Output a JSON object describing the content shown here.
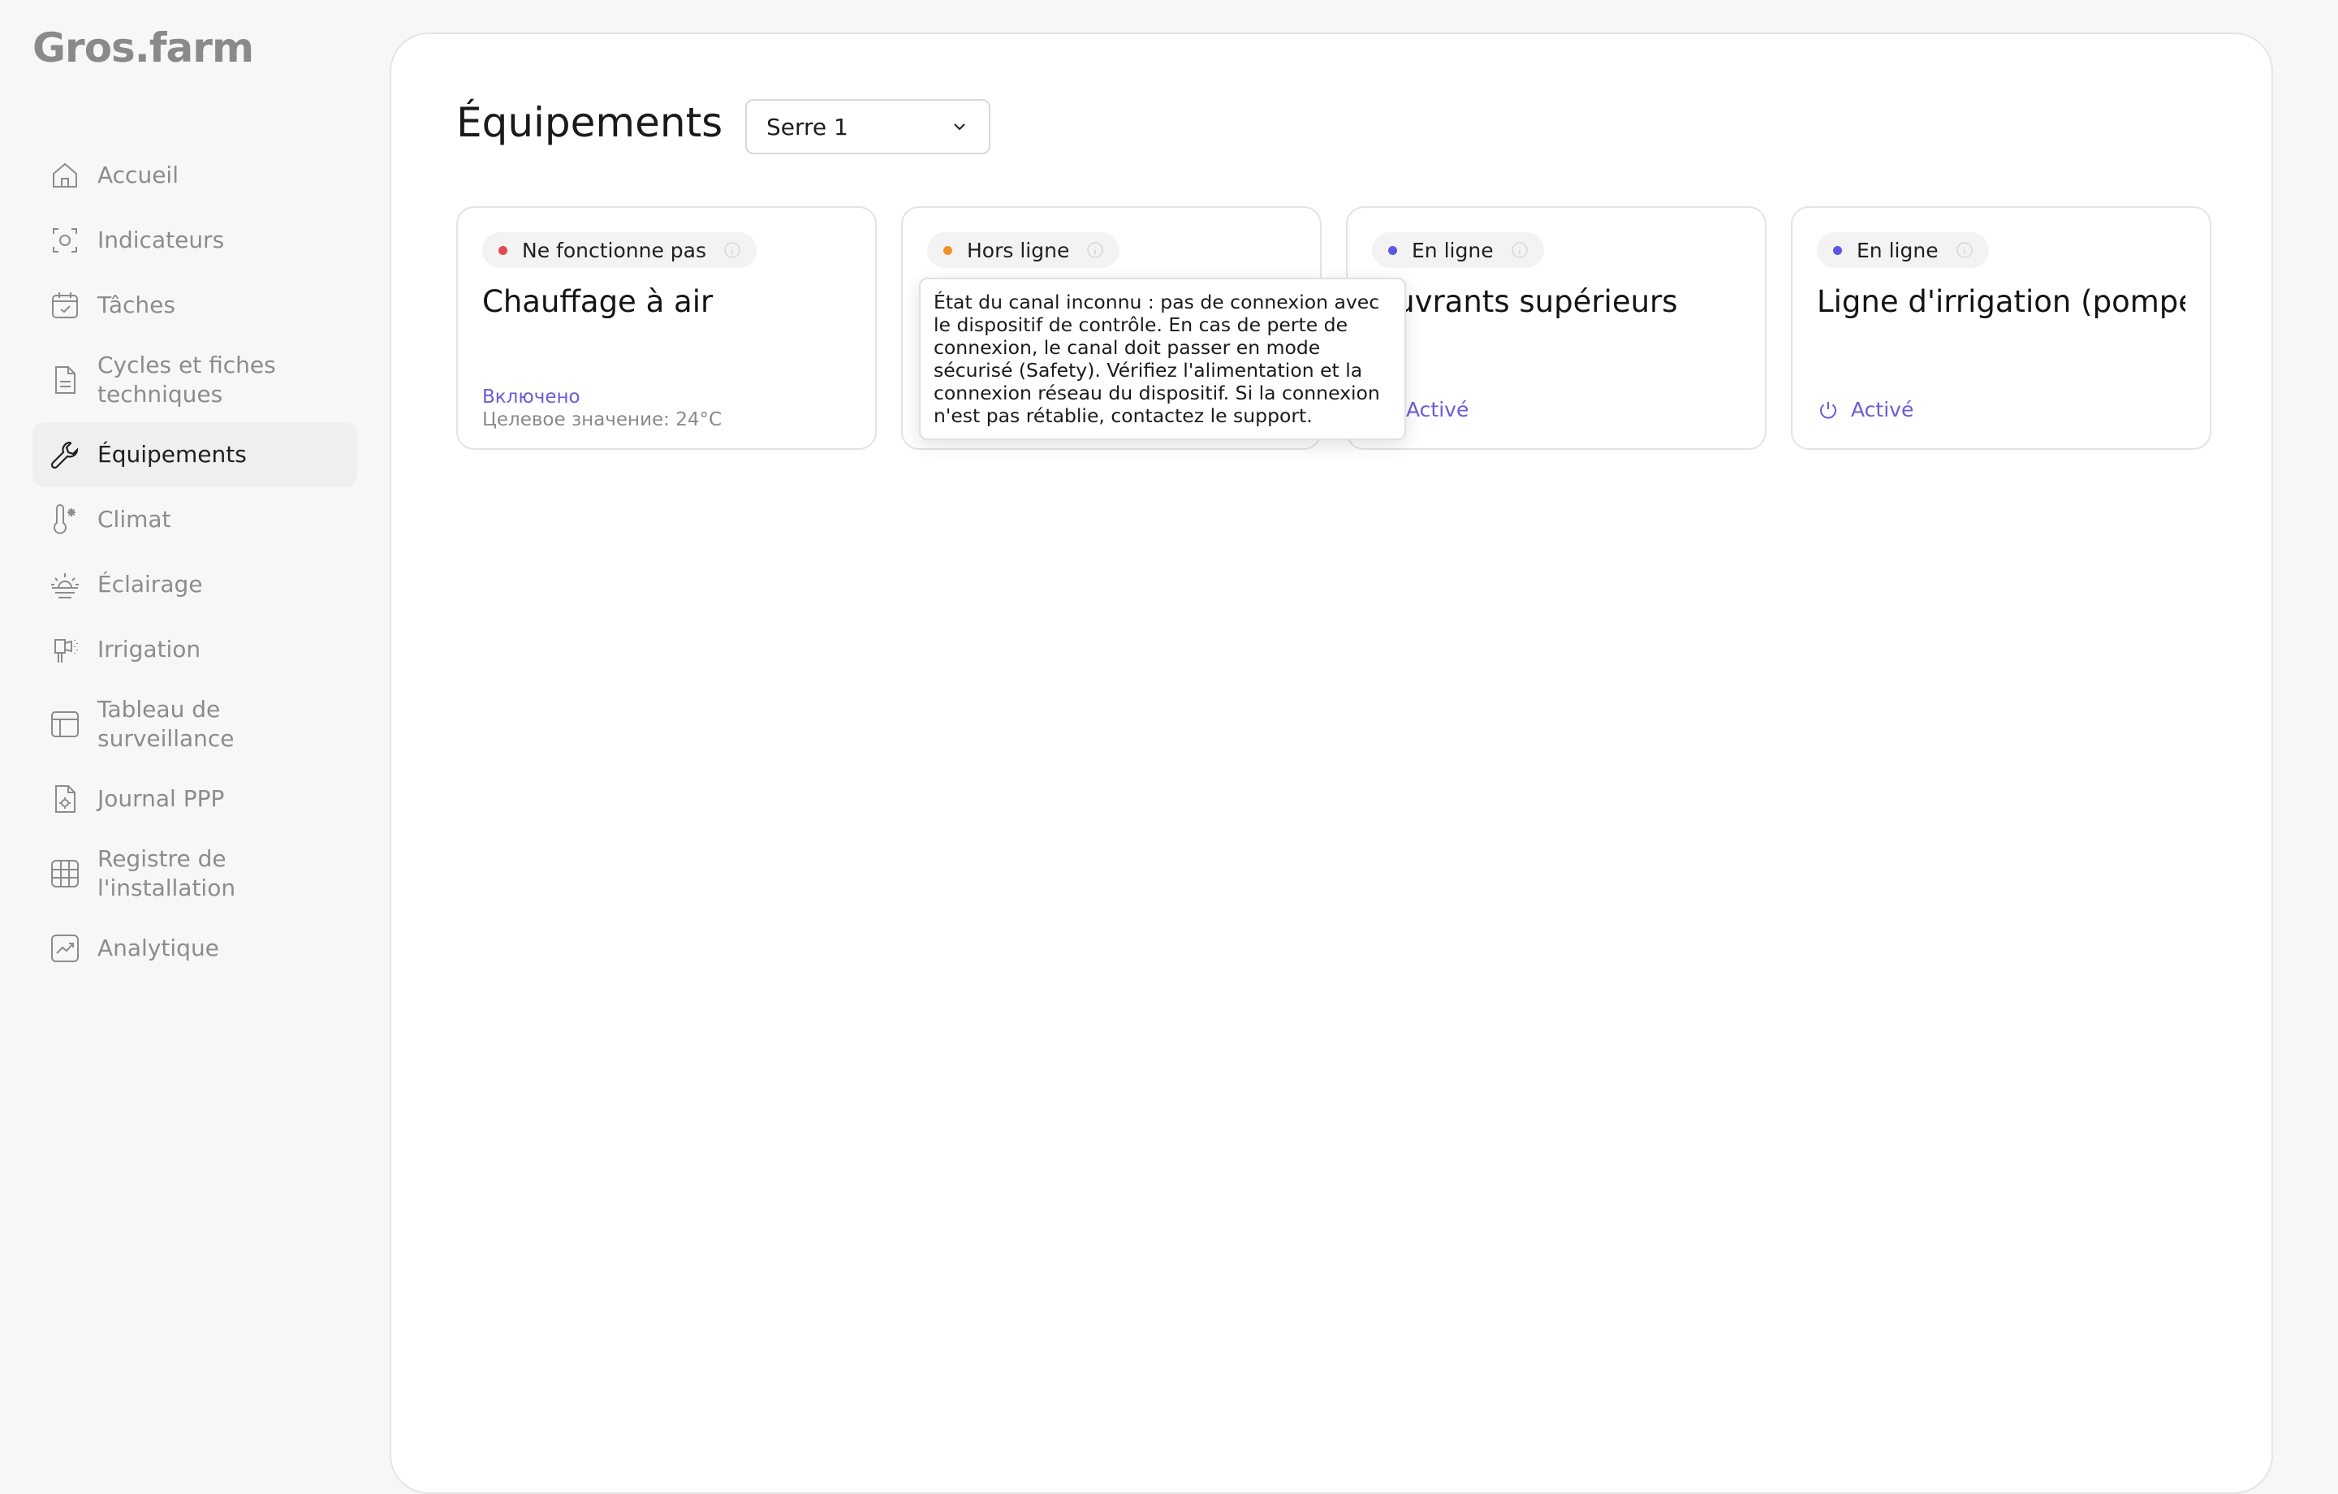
{
  "brand": {
    "logo_text": "Gros.farm"
  },
  "sidebar": {
    "items": [
      {
        "label": "Accueil",
        "icon": "home-icon"
      },
      {
        "label": "Indicateurs",
        "icon": "sensor-icon"
      },
      {
        "label": "Tâches",
        "icon": "calendar-check-icon"
      },
      {
        "label": "Cycles et fiches techniques",
        "icon": "document-icon"
      },
      {
        "label": "Équipements",
        "icon": "wrench-icon",
        "active": true
      },
      {
        "label": "Climat",
        "icon": "thermometer-icon"
      },
      {
        "label": "Éclairage",
        "icon": "sunrise-icon"
      },
      {
        "label": "Irrigation",
        "icon": "sprinkler-icon"
      },
      {
        "label": "Tableau de surveillance",
        "icon": "table-icon"
      },
      {
        "label": "Journal PPP",
        "icon": "journal-icon"
      },
      {
        "label": "Registre de l'installation",
        "icon": "grid-icon"
      },
      {
        "label": "Analytique",
        "icon": "chart-icon"
      }
    ]
  },
  "main": {
    "title": "Équipements",
    "greenhouse_select": {
      "value": "Serre 1"
    },
    "cards": [
      {
        "status": "Ne fonctionne pas",
        "status_color": "#e5484d",
        "title": "Chauffage à air",
        "state_text": "Включено",
        "target_text": "Целевое значение: 24°C"
      },
      {
        "status": "Hors ligne",
        "status_color": "#f0902a",
        "title": ""
      },
      {
        "status": "En ligne",
        "status_color": "#5b57e6",
        "title": "Ouvrants supérieurs",
        "state_text": "Activé"
      },
      {
        "status": "En ligne",
        "status_color": "#5b57e6",
        "title": "Ligne d'irrigation (pompe)",
        "state_text": "Activé"
      }
    ],
    "tooltip": {
      "text": "État du canal inconnu : pas de connexion avec le dispositif de contrôle. En cas de perte de connexion, le canal doit passer en mode sécurisé (Safety). Vérifiez l'alimentation et la connexion réseau du dispositif. Si la connexion n'est pas rétablie, contactez le support."
    }
  },
  "colors": {
    "accent": "#6a5cd6",
    "error": "#e5484d",
    "warning": "#f0902a",
    "online": "#5b57e6"
  }
}
